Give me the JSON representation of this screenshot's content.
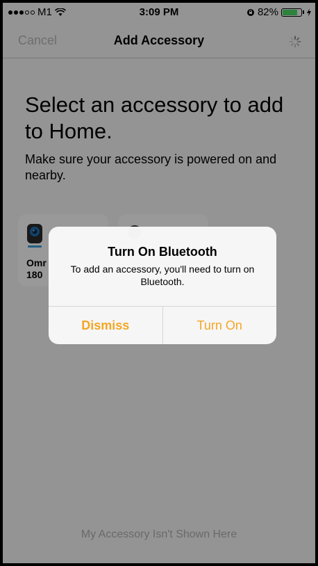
{
  "status_bar": {
    "carrier": "M1",
    "time": "3:09 PM",
    "battery_percent": "82%",
    "battery_level": 0.82
  },
  "nav": {
    "cancel_label": "Cancel",
    "title": "Add Accessory"
  },
  "main": {
    "headline": "Select an accessory to add to Home.",
    "subtext": "Make sure your accessory is powered on and nearby.",
    "accessories": [
      {
        "name_line1": "Omr",
        "name_line2": "180"
      },
      {
        "name_line1": "",
        "name_line2": ""
      }
    ],
    "footer_link": "My Accessory Isn't Shown Here"
  },
  "alert": {
    "title": "Turn On Bluetooth",
    "message": "To add an accessory, you'll need to turn on Bluetooth.",
    "dismiss_label": "Dismiss",
    "turn_on_label": "Turn On"
  },
  "colors": {
    "accent": "#f5a623",
    "battery": "#4cd964",
    "dim_overlay": "rgba(0,0,0,0.4)"
  }
}
